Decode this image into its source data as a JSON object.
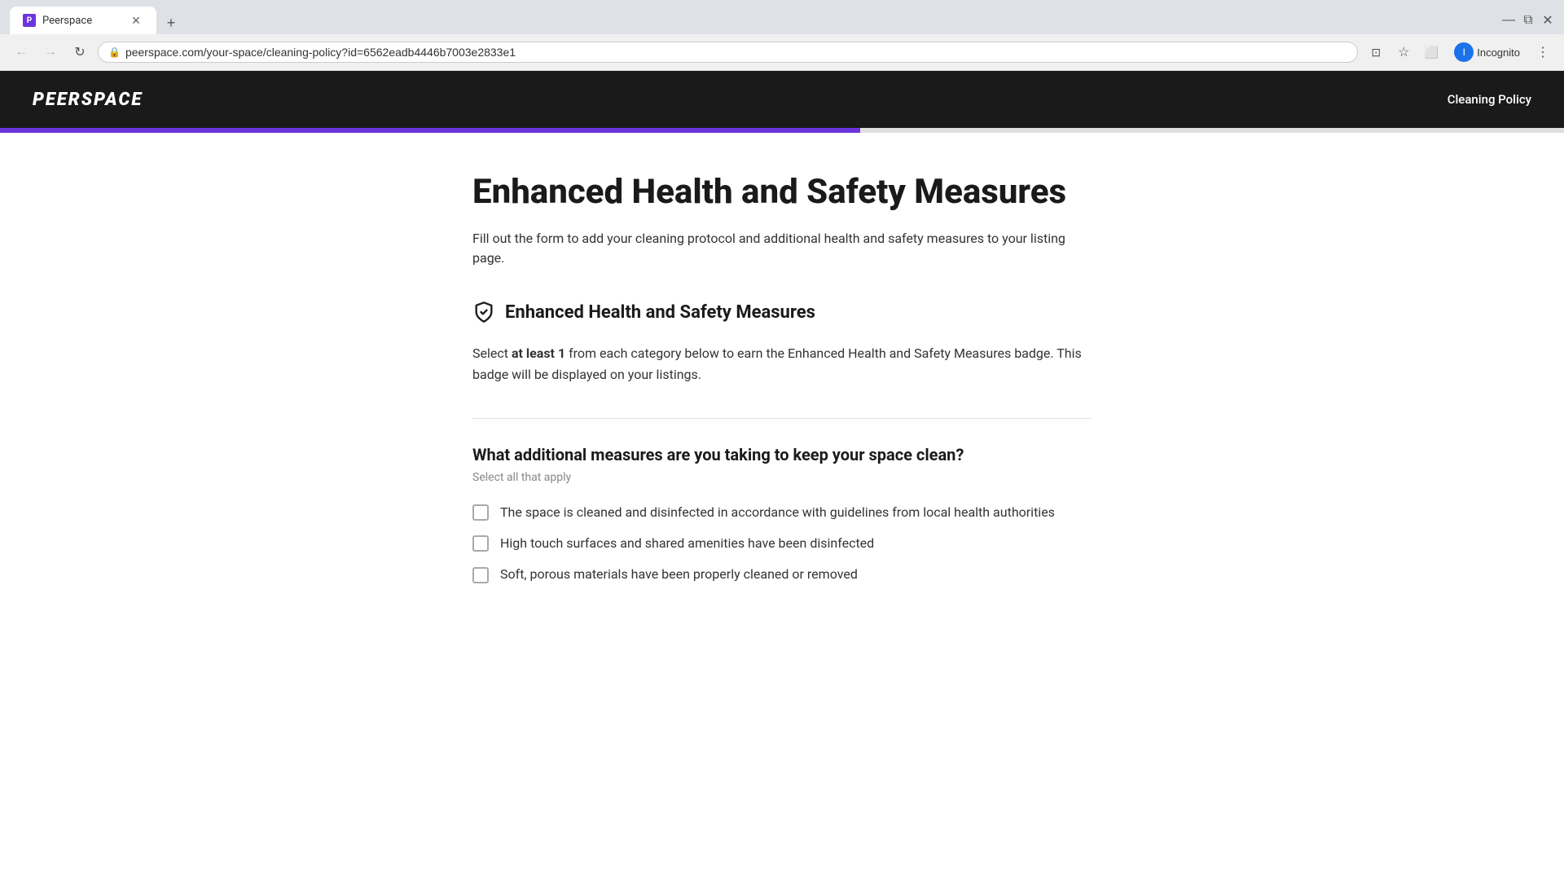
{
  "browser": {
    "tab_label": "Peerspace",
    "url": "peerspace.com/your-space/cleaning-policy?id=6562eadb4446b7003e2833e1",
    "url_full": "peerspace.com/your-space/cleaning-policy?id=6562eadb4446b7003e2833e1",
    "profile_label": "Incognito"
  },
  "header": {
    "logo": "PEERSPACE",
    "nav": {
      "cleaning_policy": "Cleaning Policy"
    }
  },
  "progress": {
    "percent": 55
  },
  "main": {
    "page_title": "Enhanced Health and Safety Measures",
    "page_description": "Fill out the form to add your cleaning protocol and additional health and safety measures to your listing page.",
    "section_title": "Enhanced Health and Safety Measures",
    "section_description_before": "Select ",
    "section_description_bold": "at least 1",
    "section_description_after": " from each category below to earn the Enhanced Health and Safety Measures badge. This badge will be displayed on your listings.",
    "question_title": "What additional measures are you taking to keep your space clean?",
    "select_hint": "Select all that apply",
    "checkboxes": [
      {
        "id": "cb1",
        "label": "The space is cleaned and disinfected in accordance with guidelines from local health authorities",
        "checked": false
      },
      {
        "id": "cb2",
        "label": "High touch surfaces and shared amenities have been disinfected",
        "checked": false
      },
      {
        "id": "cb3",
        "label": "Soft, porous materials have been properly cleaned or removed",
        "checked": false
      }
    ]
  }
}
